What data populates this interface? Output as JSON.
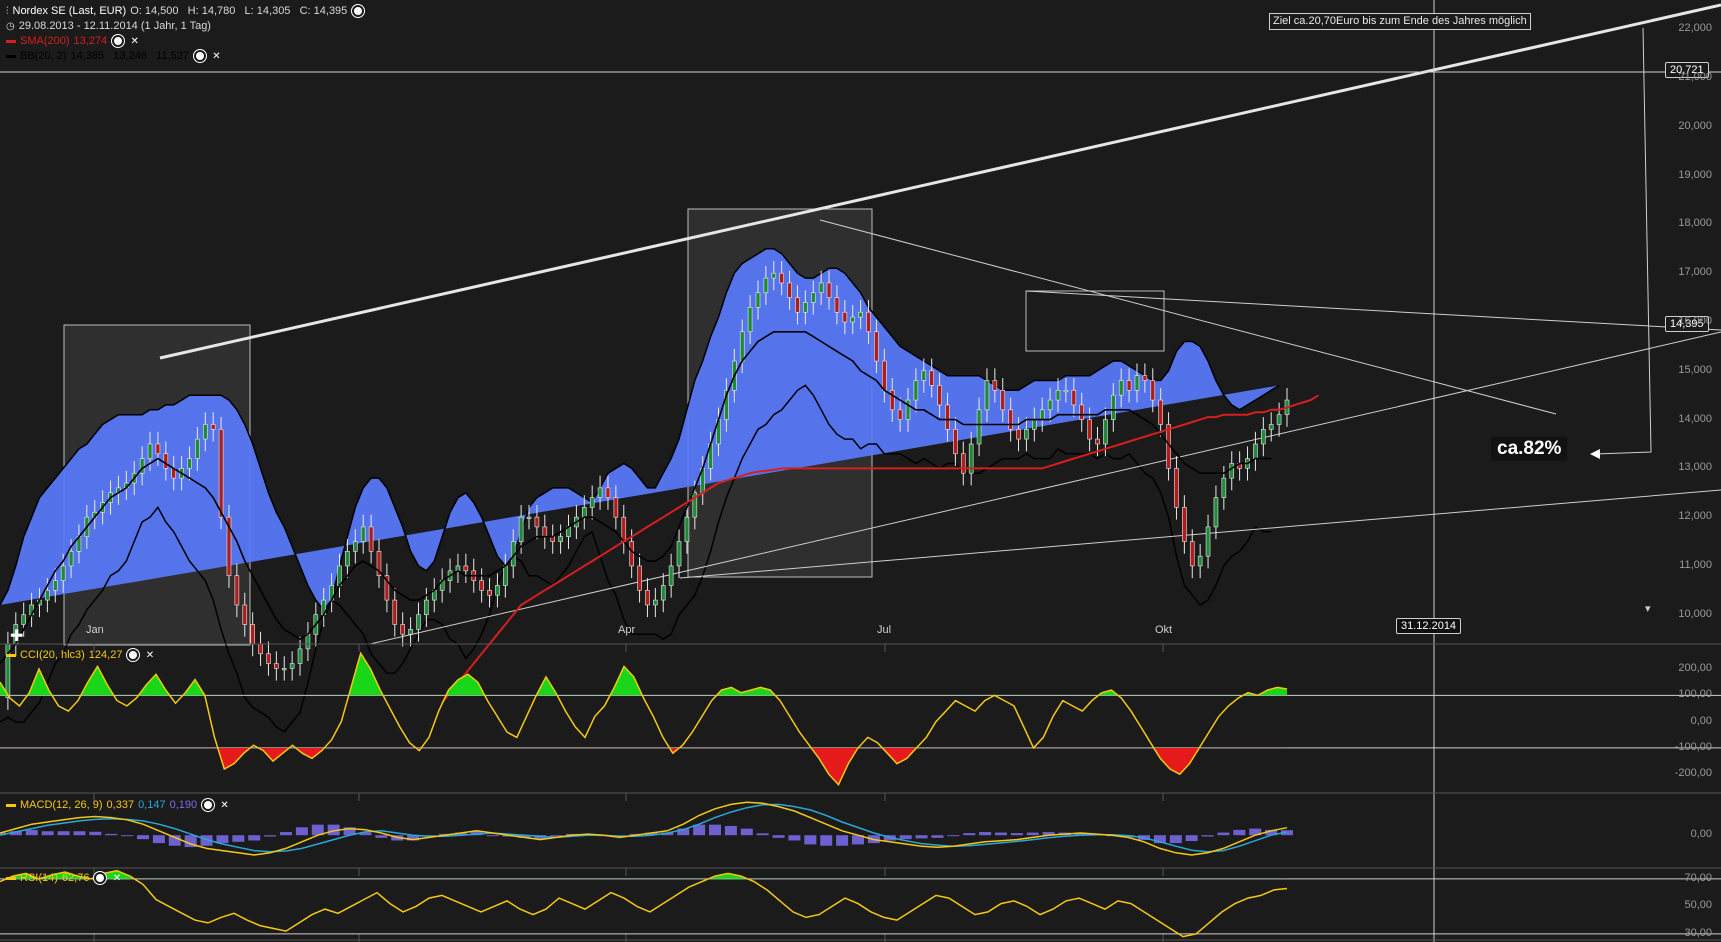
{
  "header": {
    "title": "Nordex SE (Last, EUR)",
    "ohlc": "O: 14,500   H: 14,780   L: 14,305   C: 14,395",
    "range": "29.08.2013 - 12.11.2014 (1 Jahr, 1 Tag)",
    "sma_label": "SMA(200)",
    "sma_value": "13,274",
    "bb_label": "BB(20, 2)",
    "bb_values": "14,385   13,246   11,527",
    "cci_label": "CCI(20, hlc3)",
    "cci_value": "124,27",
    "macd_label": "MACD(12, 26, 9)",
    "macd_v1": "0,337",
    "macd_v2": "0,147",
    "macd_v3": "0,190",
    "rsi_label": "RSI(14)",
    "rsi_value": "62,76"
  },
  "annotations": {
    "target_note": "Ziel ca.20,70Euro bis zum Ende des Jahres möglich",
    "percent": "ca.82%",
    "target_date": "31.12.2014",
    "level_tag": "20,721",
    "price_tag": "14,395"
  },
  "colors": {
    "background": "#1b1b1b",
    "band": "#5778f5",
    "up": "#1e8a3a",
    "down": "#b01c1c",
    "sma": "#d81e1e",
    "mid": "#000000",
    "yellow": "#f5c814",
    "cci_pos": "#19d619",
    "cci_neg": "#e51b1b",
    "macd_signal": "#2aa7d8",
    "macd_hist": "#7b6cf0"
  },
  "chart_data": [
    {
      "type": "line",
      "panel": "price",
      "xlabel": "",
      "ylabel": "",
      "x_ticks": [
        "Jan",
        "Apr",
        "Jul",
        "Okt"
      ],
      "y_ticks": [
        "10,000",
        "11,000",
        "12,000",
        "13,000",
        "14,000",
        "15,000",
        "16,000",
        "17,000",
        "18,000",
        "19,000",
        "20,000",
        "21,000",
        "22,000"
      ],
      "ylim": [
        9.4,
        22.6
      ],
      "close": [
        8.3,
        9.4,
        9.8,
        10.0,
        10.2,
        10.3,
        10.5,
        10.7,
        11.0,
        11.3,
        11.6,
        12.0,
        12.1,
        12.3,
        12.5,
        12.6,
        12.7,
        12.9,
        13.2,
        13.5,
        13.3,
        13.0,
        12.8,
        13.0,
        13.2,
        13.6,
        13.9,
        13.8,
        12.0,
        10.8,
        10.2,
        9.8,
        9.4,
        9.2,
        9.0,
        8.9,
        8.9,
        9.0,
        9.3,
        9.6,
        10.0,
        10.3,
        10.6,
        11.0,
        11.3,
        11.5,
        11.8,
        11.3,
        10.8,
        10.3,
        9.8,
        9.6,
        9.7,
        10.0,
        10.3,
        10.5,
        10.7,
        10.9,
        11.0,
        10.9,
        10.7,
        10.5,
        10.4,
        10.6,
        11.0,
        11.5,
        12.0,
        12.0,
        11.8,
        11.6,
        11.5,
        11.6,
        11.8,
        12.0,
        12.2,
        12.4,
        12.6,
        12.4,
        12.0,
        11.5,
        11.0,
        10.5,
        10.2,
        10.3,
        10.6,
        11.0,
        11.5,
        12.0,
        12.5,
        13.0,
        13.5,
        14.0,
        14.6,
        15.2,
        15.8,
        16.3,
        16.6,
        16.9,
        17.0,
        16.8,
        16.5,
        16.2,
        16.4,
        16.6,
        16.8,
        16.5,
        16.2,
        16.0,
        16.1,
        16.2,
        15.8,
        15.2,
        14.6,
        14.2,
        14.0,
        14.4,
        14.8,
        15.0,
        14.7,
        14.3,
        13.8,
        13.3,
        12.9,
        13.5,
        14.2,
        14.8,
        14.6,
        14.2,
        13.8,
        13.6,
        13.8,
        14.0,
        14.2,
        14.4,
        14.6,
        14.6,
        14.3,
        14.0,
        13.6,
        13.5,
        14.0,
        14.5,
        14.8,
        14.6,
        14.9,
        14.8,
        14.4,
        13.9,
        13.0,
        12.2,
        11.5,
        11.0,
        11.2,
        11.8,
        12.4,
        12.8,
        13.1,
        13.0,
        13.2,
        13.5,
        13.8,
        13.9,
        14.1,
        14.4
      ],
      "bb_upper": [
        10.2,
        10.5,
        11.0,
        11.6,
        12.0,
        12.4,
        12.6,
        12.8,
        13.0,
        13.2,
        13.4,
        13.5,
        13.7,
        13.9,
        14.0,
        14.1,
        14.1,
        14.1,
        14.1,
        14.2,
        14.2,
        14.3,
        14.3,
        14.4,
        14.5,
        14.5,
        14.5,
        14.5,
        14.5,
        14.4,
        14.2,
        13.9,
        13.5,
        13.0,
        12.5,
        12.1,
        11.8,
        11.4,
        11.0,
        10.6,
        10.3,
        10.1,
        10.3,
        11.0,
        11.6,
        12.2,
        12.6,
        12.8,
        12.8,
        12.6,
        12.2,
        11.8,
        11.3,
        11.0,
        10.9,
        11.1,
        11.6,
        12.1,
        12.4,
        12.5,
        12.3,
        12.0,
        11.6,
        11.2,
        11.0,
        11.2,
        11.7,
        12.2,
        12.4,
        12.5,
        12.6,
        12.6,
        12.6,
        12.5,
        12.4,
        12.3,
        12.6,
        12.9,
        13.0,
        13.1,
        13.0,
        12.8,
        12.6,
        12.6,
        12.9,
        13.2,
        13.6,
        14.2,
        14.8,
        15.2,
        15.7,
        16.1,
        16.6,
        17.0,
        17.2,
        17.3,
        17.4,
        17.5,
        17.5,
        17.4,
        17.2,
        17.0,
        16.9,
        16.9,
        17.0,
        17.1,
        17.1,
        17.0,
        16.8,
        16.6,
        16.3,
        16.1,
        15.9,
        15.7,
        15.5,
        15.4,
        15.3,
        15.2,
        15.1,
        15.0,
        14.9,
        14.9,
        14.9,
        14.9,
        14.9,
        14.8,
        14.7,
        14.6,
        14.6,
        14.6,
        14.7,
        14.8,
        14.8,
        14.8,
        14.8,
        14.9,
        14.9,
        14.9,
        14.9,
        15.0,
        15.1,
        15.2,
        15.2,
        15.1,
        15.0,
        14.9,
        14.8,
        14.8,
        15.0,
        15.4,
        15.6,
        15.6,
        15.5,
        15.2,
        14.8,
        14.5,
        14.3,
        14.2,
        14.3,
        14.4,
        14.5,
        14.6,
        14.7
      ],
      "bb_mid": [
        9.0,
        9.2,
        9.4,
        9.7,
        10.0,
        10.3,
        10.6,
        10.9,
        11.1,
        11.4,
        11.6,
        11.8,
        12.0,
        12.2,
        12.4,
        12.5,
        12.6,
        12.8,
        13.0,
        13.1,
        13.2,
        13.1,
        13.0,
        12.9,
        12.8,
        12.7,
        12.6,
        12.4,
        12.1,
        11.8,
        11.5,
        11.1,
        10.8,
        10.5,
        10.2,
        9.9,
        9.7,
        9.6,
        9.5,
        9.6,
        9.8,
        10.0,
        10.3,
        10.6,
        10.8,
        11.0,
        11.1,
        11.0,
        10.9,
        10.7,
        10.5,
        10.4,
        10.3,
        10.3,
        10.4,
        10.5,
        10.7,
        10.8,
        10.9,
        10.8,
        10.8,
        10.8,
        10.8,
        10.9,
        11.0,
        11.2,
        11.4,
        11.5,
        11.6,
        11.6,
        11.6,
        11.7,
        11.8,
        11.9,
        12.0,
        12.0,
        11.9,
        11.8,
        11.7,
        11.5,
        11.3,
        11.2,
        11.1,
        11.1,
        11.2,
        11.4,
        11.8,
        12.2,
        12.6,
        13.0,
        13.5,
        14.0,
        14.5,
        14.9,
        15.2,
        15.4,
        15.6,
        15.7,
        15.8,
        15.8,
        15.8,
        15.8,
        15.8,
        15.7,
        15.6,
        15.5,
        15.4,
        15.3,
        15.2,
        15.0,
        14.9,
        14.8,
        14.6,
        14.5,
        14.4,
        14.3,
        14.2,
        14.2,
        14.1,
        14.0,
        14.0,
        14.0,
        13.9,
        13.9,
        13.9,
        13.9,
        13.9,
        13.9,
        13.9,
        13.9,
        14.0,
        14.0,
        14.0,
        14.0,
        14.1,
        14.1,
        14.1,
        14.1,
        14.1,
        14.1,
        14.2,
        14.2,
        14.2,
        14.2,
        14.1,
        14.0,
        13.9,
        13.7,
        13.5,
        13.3,
        13.1,
        13.0,
        12.9,
        12.9,
        12.9,
        12.9,
        13.0,
        13.1,
        13.1,
        13.2,
        13.2,
        13.2
      ],
      "bb_lower": [
        7.8,
        7.9,
        7.8,
        7.8,
        8.0,
        8.2,
        8.6,
        9.0,
        9.2,
        9.6,
        9.8,
        10.1,
        10.3,
        10.5,
        10.8,
        10.9,
        11.1,
        11.5,
        11.9,
        12.0,
        12.2,
        11.9,
        11.7,
        11.4,
        11.1,
        10.9,
        10.7,
        10.3,
        9.7,
        9.2,
        8.8,
        8.3,
        8.1,
        8.0,
        7.9,
        7.7,
        7.6,
        7.8,
        8.0,
        8.6,
        9.3,
        9.9,
        10.3,
        10.2,
        10.0,
        9.8,
        9.6,
        9.2,
        9.0,
        8.8,
        8.8,
        9.0,
        9.3,
        9.6,
        9.9,
        9.9,
        9.8,
        9.5,
        9.4,
        9.1,
        9.3,
        9.6,
        10.0,
        10.6,
        11.0,
        11.2,
        11.1,
        10.8,
        10.8,
        10.7,
        10.6,
        10.8,
        11.0,
        11.3,
        11.6,
        11.7,
        11.2,
        10.7,
        10.4,
        9.9,
        9.6,
        9.6,
        9.6,
        9.6,
        9.5,
        9.6,
        10.0,
        10.2,
        10.4,
        10.8,
        11.3,
        11.9,
        12.4,
        12.8,
        13.2,
        13.5,
        13.8,
        13.9,
        14.1,
        14.2,
        14.4,
        14.6,
        14.7,
        14.5,
        14.2,
        13.9,
        13.7,
        13.6,
        13.6,
        13.4,
        13.5,
        13.5,
        13.3,
        13.3,
        13.3,
        13.2,
        13.1,
        13.2,
        13.1,
        13.0,
        13.1,
        13.1,
        12.9,
        12.9,
        12.9,
        13.0,
        13.1,
        13.2,
        13.2,
        13.2,
        13.3,
        13.2,
        13.2,
        13.2,
        13.4,
        13.3,
        13.3,
        13.3,
        13.3,
        13.2,
        13.3,
        13.2,
        13.2,
        13.3,
        13.1,
        12.9,
        12.8,
        12.5,
        12.0,
        11.2,
        10.6,
        10.4,
        10.2,
        10.3,
        10.6,
        11.0,
        11.2,
        11.3,
        11.5,
        11.8,
        11.7,
        11.7
      ],
      "sma200": [
        null,
        null,
        null,
        null,
        null,
        null,
        null,
        null,
        null,
        null,
        null,
        null,
        null,
        null,
        null,
        null,
        null,
        null,
        null,
        null,
        null,
        null,
        null,
        null,
        null,
        null,
        null,
        null,
        null,
        null,
        null,
        null,
        null,
        null,
        null,
        null,
        null,
        null,
        null,
        null,
        null,
        null,
        null,
        null,
        null,
        null,
        null,
        null,
        null,
        null,
        null,
        null,
        null,
        null,
        null,
        null,
        8.2,
        8.4,
        8.6,
        8.8,
        9.0,
        9.2,
        9.4,
        9.6,
        9.8,
        10.0,
        10.2,
        10.3,
        10.4,
        10.5,
        10.6,
        10.7,
        10.8,
        10.9,
        11.0,
        11.1,
        11.2,
        11.3,
        11.4,
        11.5,
        11.6,
        11.7,
        11.8,
        11.9,
        12.0,
        12.1,
        12.2,
        12.3,
        12.4,
        12.5,
        12.6,
        12.7,
        12.75,
        12.8,
        12.85,
        12.9,
        12.93,
        12.95,
        12.97,
        13.0,
        13.0,
        13.0,
        13.0,
        13.0,
        13.0,
        13.0,
        13.0,
        13.0,
        13.0,
        13.0,
        13.0,
        13.0,
        13.0,
        13.0,
        13.0,
        13.0,
        13.0,
        13.0,
        13.0,
        13.0,
        13.0,
        13.0,
        13.0,
        13.0,
        13.0,
        13.0,
        13.0,
        13.0,
        13.0,
        13.0,
        13.0,
        13.0,
        13.0,
        13.05,
        13.1,
        13.15,
        13.2,
        13.25,
        13.3,
        13.35,
        13.4,
        13.45,
        13.5,
        13.55,
        13.6,
        13.65,
        13.7,
        13.75,
        13.8,
        13.85,
        13.9,
        13.95,
        14.0,
        14.05,
        14.05,
        14.1,
        14.1,
        14.1,
        14.1,
        14.15,
        14.15,
        14.2,
        14.2,
        14.25,
        14.3,
        14.35,
        14.4,
        14.5
      ]
    },
    {
      "type": "area",
      "panel": "cci",
      "y_ticks": [
        "200,00",
        "100,00",
        "0,00",
        "-100,00",
        "-200,00"
      ],
      "ylim": [
        -260,
        280
      ],
      "values": [
        150,
        90,
        60,
        110,
        200,
        120,
        60,
        40,
        80,
        150,
        210,
        140,
        80,
        60,
        90,
        140,
        180,
        120,
        70,
        110,
        160,
        100,
        -60,
        -180,
        -160,
        -120,
        -90,
        -110,
        -150,
        -120,
        -90,
        -120,
        -140,
        -110,
        -70,
        0,
        130,
        260,
        200,
        120,
        50,
        -20,
        -80,
        -110,
        -60,
        40,
        120,
        160,
        180,
        150,
        80,
        20,
        -40,
        -60,
        20,
        100,
        170,
        110,
        40,
        -20,
        -60,
        20,
        60,
        130,
        210,
        170,
        90,
        20,
        -60,
        -120,
        -90,
        -40,
        20,
        80,
        120,
        130,
        110,
        120,
        130,
        120,
        80,
        20,
        -40,
        -90,
        -140,
        -200,
        -240,
        -160,
        -100,
        -60,
        -80,
        -120,
        -160,
        -140,
        -100,
        -60,
        0,
        40,
        80,
        60,
        40,
        80,
        100,
        80,
        60,
        -20,
        -100,
        -60,
        20,
        80,
        60,
        40,
        80,
        110,
        120,
        90,
        40,
        -20,
        -80,
        -140,
        -180,
        -200,
        -160,
        -100,
        -40,
        20,
        60,
        90,
        110,
        100,
        120,
        130,
        124
      ]
    },
    {
      "type": "line",
      "panel": "macd",
      "y_ticks": [
        "0,00"
      ],
      "ylim": [
        -1.4,
        1.6
      ],
      "macd": [
        0.1,
        0.3,
        0.5,
        0.6,
        0.7,
        0.8,
        0.85,
        0.8,
        0.7,
        0.5,
        0.2,
        -0.1,
        -0.4,
        -0.6,
        -0.7,
        -0.8,
        -0.9,
        -0.8,
        -0.6,
        -0.3,
        0.0,
        0.2,
        0.3,
        0.25,
        0.1,
        -0.1,
        -0.2,
        -0.1,
        0.0,
        0.1,
        0.2,
        0.1,
        0.0,
        -0.1,
        -0.2,
        -0.1,
        0.0,
        0.05,
        0.0,
        -0.1,
        0.0,
        0.1,
        0.2,
        0.5,
        0.9,
        1.2,
        1.4,
        1.5,
        1.45,
        1.3,
        1.1,
        0.8,
        0.5,
        0.2,
        0.0,
        -0.2,
        -0.3,
        -0.4,
        -0.5,
        -0.55,
        -0.5,
        -0.4,
        -0.3,
        -0.25,
        -0.2,
        -0.1,
        0.0,
        0.05,
        0.1,
        0.05,
        0.0,
        -0.1,
        -0.3,
        -0.6,
        -0.8,
        -0.9,
        -0.8,
        -0.6,
        -0.3,
        0.0,
        0.2,
        0.34
      ],
      "signal": [
        0.0,
        0.15,
        0.3,
        0.45,
        0.55,
        0.65,
        0.72,
        0.75,
        0.72,
        0.65,
        0.5,
        0.3,
        0.05,
        -0.2,
        -0.4,
        -0.55,
        -0.7,
        -0.75,
        -0.72,
        -0.6,
        -0.4,
        -0.2,
        0.0,
        0.15,
        0.2,
        0.1,
        0.0,
        -0.05,
        -0.05,
        0.0,
        0.05,
        0.1,
        0.05,
        0.0,
        -0.05,
        -0.1,
        -0.05,
        0.0,
        0.0,
        -0.05,
        -0.05,
        0.0,
        0.1,
        0.25,
        0.5,
        0.8,
        1.05,
        1.25,
        1.38,
        1.4,
        1.3,
        1.15,
        0.9,
        0.6,
        0.35,
        0.1,
        -0.1,
        -0.25,
        -0.38,
        -0.45,
        -0.5,
        -0.48,
        -0.42,
        -0.35,
        -0.28,
        -0.2,
        -0.12,
        -0.05,
        0.0,
        0.02,
        0.02,
        -0.02,
        -0.12,
        -0.3,
        -0.5,
        -0.68,
        -0.75,
        -0.7,
        -0.5,
        -0.25,
        0.0,
        0.15
      ]
    },
    {
      "type": "area",
      "panel": "rsi",
      "y_ticks": [
        "70,00",
        "50,00",
        "30,00"
      ],
      "ylim": [
        27,
        75
      ],
      "values": [
        68,
        72,
        74,
        70,
        73,
        75,
        72,
        70,
        74,
        76,
        72,
        66,
        55,
        50,
        45,
        40,
        38,
        42,
        45,
        40,
        36,
        34,
        32,
        38,
        44,
        48,
        45,
        50,
        55,
        60,
        52,
        46,
        50,
        56,
        58,
        54,
        50,
        46,
        50,
        54,
        48,
        44,
        48,
        56,
        52,
        48,
        54,
        60,
        56,
        50,
        46,
        52,
        58,
        64,
        68,
        72,
        74,
        72,
        68,
        62,
        54,
        46,
        42,
        44,
        50,
        56,
        52,
        46,
        42,
        40,
        46,
        52,
        58,
        56,
        50,
        44,
        46,
        52,
        54,
        50,
        44,
        48,
        54,
        56,
        52,
        48,
        54,
        52,
        46,
        40,
        34,
        28,
        30,
        38,
        46,
        52,
        56,
        58,
        62,
        63
      ]
    }
  ]
}
